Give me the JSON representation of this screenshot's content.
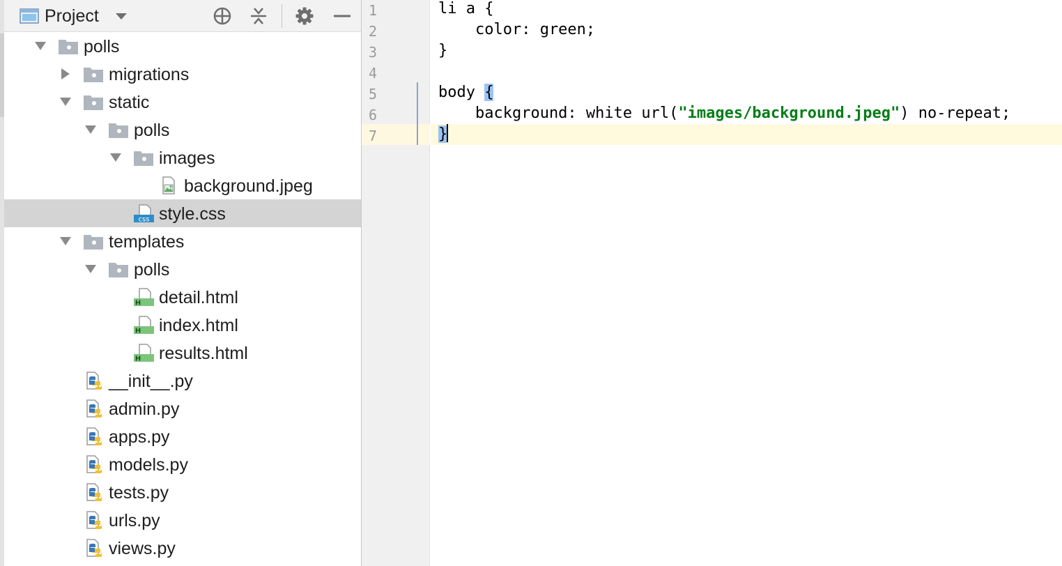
{
  "project_panel": {
    "title": "Project",
    "icons": {
      "view_selector": "project-view-icon",
      "dropdown": "chevron-down-icon",
      "locate": "crosshair-icon",
      "collapse": "collapse-all-icon",
      "settings": "gear-icon",
      "hide": "minimize-icon"
    },
    "tree": [
      {
        "label": "polls",
        "type": "folder",
        "expanded": true
      },
      {
        "label": "migrations",
        "type": "folder",
        "expanded": false
      },
      {
        "label": "static",
        "type": "folder",
        "expanded": true
      },
      {
        "label": "polls",
        "type": "folder",
        "expanded": true
      },
      {
        "label": "images",
        "type": "folder",
        "expanded": true
      },
      {
        "label": "background.jpeg",
        "type": "image-file"
      },
      {
        "label": "style.css",
        "type": "css-file",
        "selected": true
      },
      {
        "label": "templates",
        "type": "folder",
        "expanded": true
      },
      {
        "label": "polls",
        "type": "folder",
        "expanded": true
      },
      {
        "label": "detail.html",
        "type": "html-file"
      },
      {
        "label": "index.html",
        "type": "html-file"
      },
      {
        "label": "results.html",
        "type": "html-file"
      },
      {
        "label": "__init__.py",
        "type": "python-file"
      },
      {
        "label": "admin.py",
        "type": "python-file"
      },
      {
        "label": "apps.py",
        "type": "python-file"
      },
      {
        "label": "models.py",
        "type": "python-file"
      },
      {
        "label": "tests.py",
        "type": "python-file"
      },
      {
        "label": "urls.py",
        "type": "python-file"
      },
      {
        "label": "views.py",
        "type": "python-file"
      }
    ]
  },
  "editor": {
    "line_numbers": [
      "1",
      "2",
      "3",
      "4",
      "5",
      "6",
      "7"
    ],
    "lines": {
      "l1": "li a {",
      "l2": "    color: green;",
      "l3": "}",
      "l4": "",
      "l5_text": "body ",
      "l5_brace": "{",
      "l6_prefix": "    background: white url(",
      "l6_string": "\"images/background.jpeg\"",
      "l6_suffix": ") no-repeat;",
      "l7_brace": "}"
    },
    "current_line": "7",
    "colors": {
      "string": "#067d17",
      "brace_highlight": "#9cc4f2",
      "current_line_bg": "#fff9de"
    }
  }
}
